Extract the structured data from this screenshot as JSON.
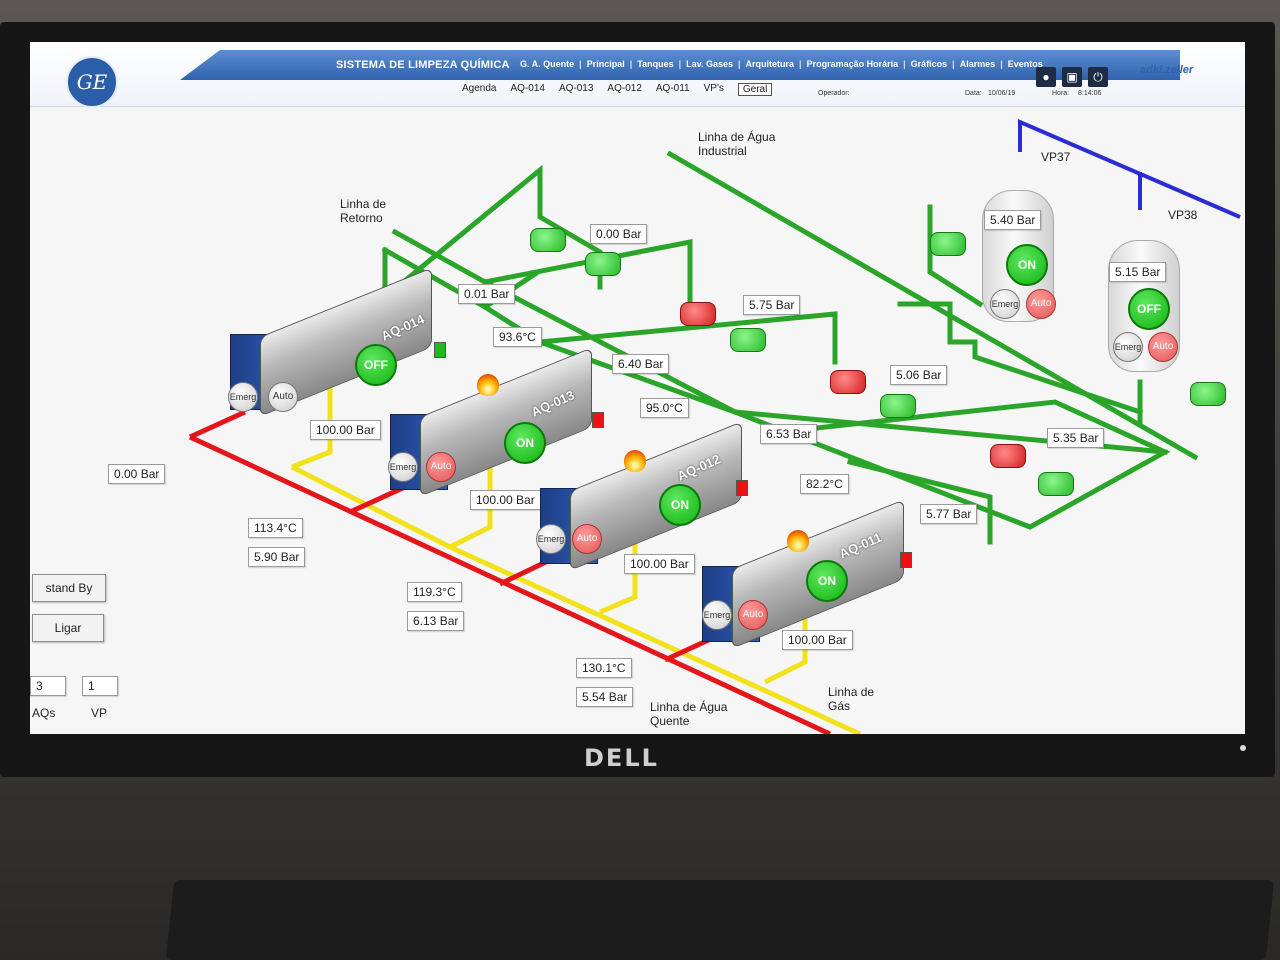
{
  "header": {
    "system_title": "SISTEMA DE LIMPEZA QUÍMICA",
    "nav": [
      "G. A. Quente",
      "Principal",
      "Tanques",
      "Lav. Gases",
      "Arquitetura",
      "Programação Horária",
      "Gráficos",
      "Alarmes",
      "Eventos"
    ],
    "brand": "adkl.zeller",
    "logo": "GE",
    "icons": [
      "user-icon",
      "lock-icon",
      "power-icon"
    ]
  },
  "subnav": {
    "items": [
      "Agenda",
      "AQ-014",
      "AQ-013",
      "AQ-012",
      "AQ-011",
      "VP's",
      "Geral"
    ],
    "active": "Geral",
    "operador_label": "Operador:",
    "data_label": "Data:",
    "data_value": "10/06/19",
    "hora_label": "Hora:",
    "hora_value": "8:14:06"
  },
  "labels": {
    "linha_industrial": "Linha de Água\nIndustrial",
    "linha_retorno": "Linha de\nRetorno",
    "linha_quente": "Linha de Água\nQuente",
    "linha_gas": "Linha de\nGás",
    "vp37": "VP37",
    "vp38": "VP38"
  },
  "boilers": [
    {
      "name": "AQ-014",
      "state": "OFF",
      "pressure": "100.00 Bar",
      "emerg": "Emerg",
      "auto": "Auto"
    },
    {
      "name": "AQ-013",
      "state": "ON",
      "pressure": "100.00 Bar",
      "temp": "93.6°C",
      "emerg": "Emerg",
      "auto": "Auto"
    },
    {
      "name": "AQ-012",
      "state": "ON",
      "pressure": "100.00 Bar",
      "temp": "95.0°C",
      "emerg": "Emerg",
      "auto": "Auto"
    },
    {
      "name": "AQ-011",
      "state": "ON",
      "pressure": "100.00 Bar",
      "temp": "82.2°C",
      "emerg": "Emerg",
      "auto": "Auto"
    }
  ],
  "vessels": [
    {
      "name": "VP37",
      "pressure": "5.40 Bar",
      "state": "ON",
      "emerg": "Emerg",
      "auto": "Auto"
    },
    {
      "name": "VP38",
      "pressure": "5.15 Bar",
      "state": "OFF",
      "emerg": "Emerg",
      "auto": "Auto"
    }
  ],
  "readings": {
    "p_000": "0.00 Bar",
    "p_001": "0.01 Bar",
    "p_575": "5.75 Bar",
    "p_640": "6.40 Bar",
    "p_506": "5.06 Bar",
    "p_653": "6.53 Bar",
    "p_535": "5.35 Bar",
    "p_577": "5.77 Bar",
    "p_left": "0.00 Bar",
    "t_1134": "113.4°C",
    "p_590": "5.90 Bar",
    "t_1193": "119.3°C",
    "p_613": "6.13 Bar",
    "t_1301": "130.1°C",
    "p_554": "5.54 Bar"
  },
  "controls": {
    "standby": "stand By",
    "ligar": "Ligar",
    "aqs_value": "3",
    "vp_value": "1",
    "aqs_label": "AQs",
    "vp_label": "VP"
  },
  "monitor_brand": "DELL",
  "colors": {
    "pipe_green": "#2aa52a",
    "pipe_red": "#e3161b",
    "pipe_yellow": "#f2e21a",
    "pipe_blue": "#2b2bd6",
    "header_blue": "#2f63ad",
    "on_green": "#12b312",
    "auto_red": "#e05656"
  }
}
